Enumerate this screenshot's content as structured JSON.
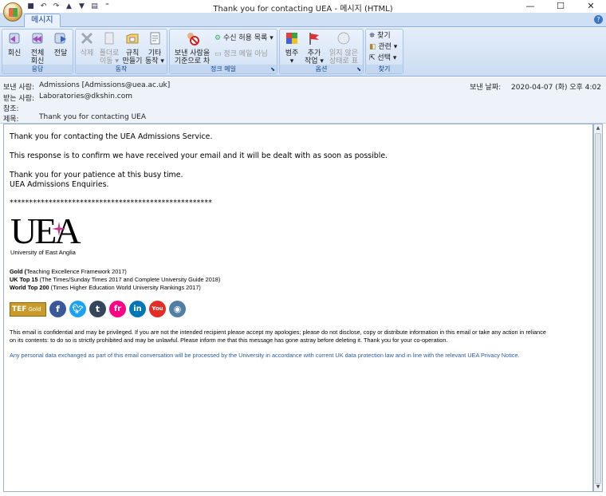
{
  "window": {
    "title": "Thank you for contacting UEA - 메시지 (HTML)",
    "controls": {
      "min": "—",
      "max": "☐",
      "close": "✕"
    }
  },
  "ribbon": {
    "tab": "메시지",
    "groups": {
      "respond": {
        "label": "응답",
        "reply": "회신",
        "reply_all_1": "전체",
        "reply_all_2": "회신",
        "forward": "전달"
      },
      "actions": {
        "label": "동작",
        "delete": "삭제",
        "move_1": "폴더로",
        "move_2": "이동 ▾",
        "rules_1": "규칙",
        "rules_2": "만들기",
        "other_1": "기타",
        "other_2": "동작 ▾"
      },
      "junk": {
        "label": "정크 메일",
        "block_1": "보낸 사람을",
        "block_2": "기준으로 차단",
        "safe_list": "수신 허용 목록 ▾",
        "not_junk": "정크 메일 아님"
      },
      "options": {
        "label": "옵션",
        "categorize_1": "범주",
        "categorize_2": "▾",
        "followup_1": "추가",
        "followup_2": "작업 ▾",
        "unread_1": "읽지 않은",
        "unread_2": "상태로 표시"
      },
      "find": {
        "label": "찾기",
        "find": "찾기",
        "related": "관련 ▾",
        "select": "선택 ▾"
      }
    }
  },
  "header": {
    "from_label": "보낸 사람:",
    "from_value": "Admissions [Admissions@uea.ac.uk]",
    "to_label": "받는 사람:",
    "to_value": "Laboratories@dkshin.com",
    "cc_label": "참조:",
    "cc_value": "",
    "subject_label": "제목:",
    "subject_value": "Thank you for contacting UEA",
    "sent_label": "보낸 날짜:",
    "sent_value": "2020-04-07 (화) 오후 4:02"
  },
  "body": {
    "line1": "Thank you for contacting the UEA Admissions Service.",
    "line2": "This response is to confirm we have received your email and it will be dealt with as soon as possible.",
    "line3": "Thank you for your patience at this busy time.",
    "line4": "UEA Admissions Enquiries.",
    "stars": "****************************************************",
    "logo_text": "UEA",
    "logo_caption": "University of East Anglia",
    "award1_bold": "Gold (",
    "award1_rest": "Teaching Excellence Framework 2017)",
    "award2_bold": "UK Top 15",
    "award2_rest": " (The Times/Sunday Times 2017 and Complete University Guide 2018)",
    "award3_bold": "World Top 200",
    "award3_rest": " (Times Higher Education World University Rankings 2017)",
    "tef_label": "TEF",
    "tef_gold": "Gold",
    "social": [
      {
        "name": "facebook",
        "glyph": "f",
        "color": "#3b5998"
      },
      {
        "name": "twitter",
        "glyph": "t",
        "color": "#1da1f2"
      },
      {
        "name": "tumblr",
        "glyph": "t",
        "color": "#35465c"
      },
      {
        "name": "flickr",
        "glyph": "fr",
        "color": "#ff0084"
      },
      {
        "name": "linkedin",
        "glyph": "in",
        "color": "#0077b5"
      },
      {
        "name": "youtube",
        "glyph": "You",
        "color": "#e52d27"
      },
      {
        "name": "instagram",
        "glyph": "◉",
        "color": "#517fa4"
      }
    ],
    "disclaimer1": "This email is confidential and may be privileged. If you are not the intended recipient please accept my apologies; please do not disclose, copy or distribute information in this email or take any action in reliance",
    "disclaimer2": "on its contents: to do so is strictly prohibited and may be unlawful. Please inform me that this message has gone astray before deleting it. Thank you for your co-operation.",
    "privacy": "Any personal data exchanged as part of this email conversation will be processed by the University in accordance with current UK data protection law and in line with the relevant UEA Privacy Notice."
  }
}
